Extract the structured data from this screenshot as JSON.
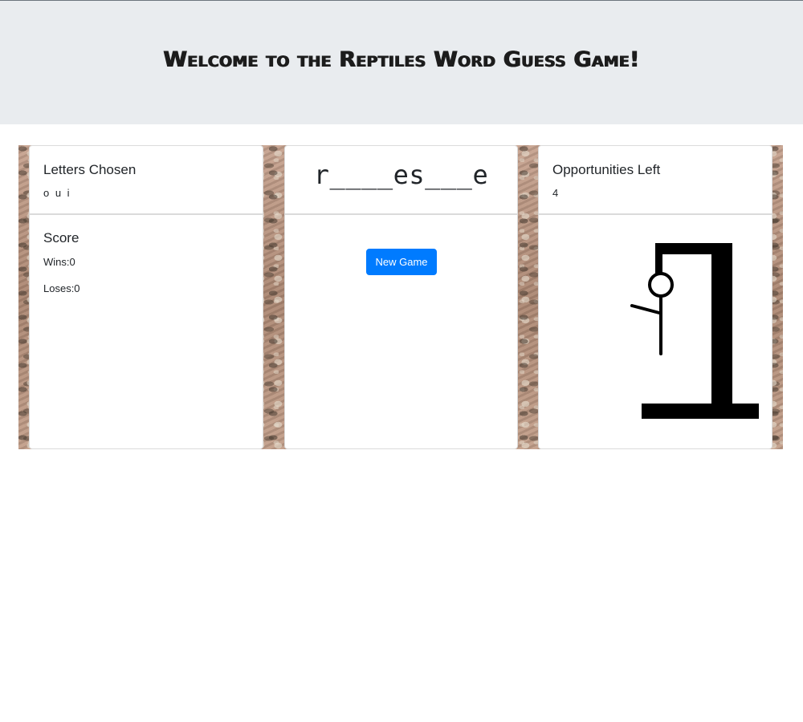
{
  "header": {
    "title": "Welcome to the Reptiles Word Guess Game!"
  },
  "letters_chosen": {
    "title": "Letters Chosen",
    "letters": "o u i"
  },
  "score": {
    "title": "Score",
    "wins": "Wins:0",
    "loses": "Loses:0"
  },
  "word": {
    "display": "r____es___e"
  },
  "game": {
    "new_game_label": "New Game"
  },
  "opportunities": {
    "title": "Opportunities Left",
    "value": "4"
  },
  "colors": {
    "header_bg": "#e9ecef",
    "button_bg": "#007bff",
    "button_text": "#ffffff",
    "hangman_stroke": "#000000"
  },
  "hangman": {
    "image": "hangman-gallows-with-head-body-one-arm"
  }
}
